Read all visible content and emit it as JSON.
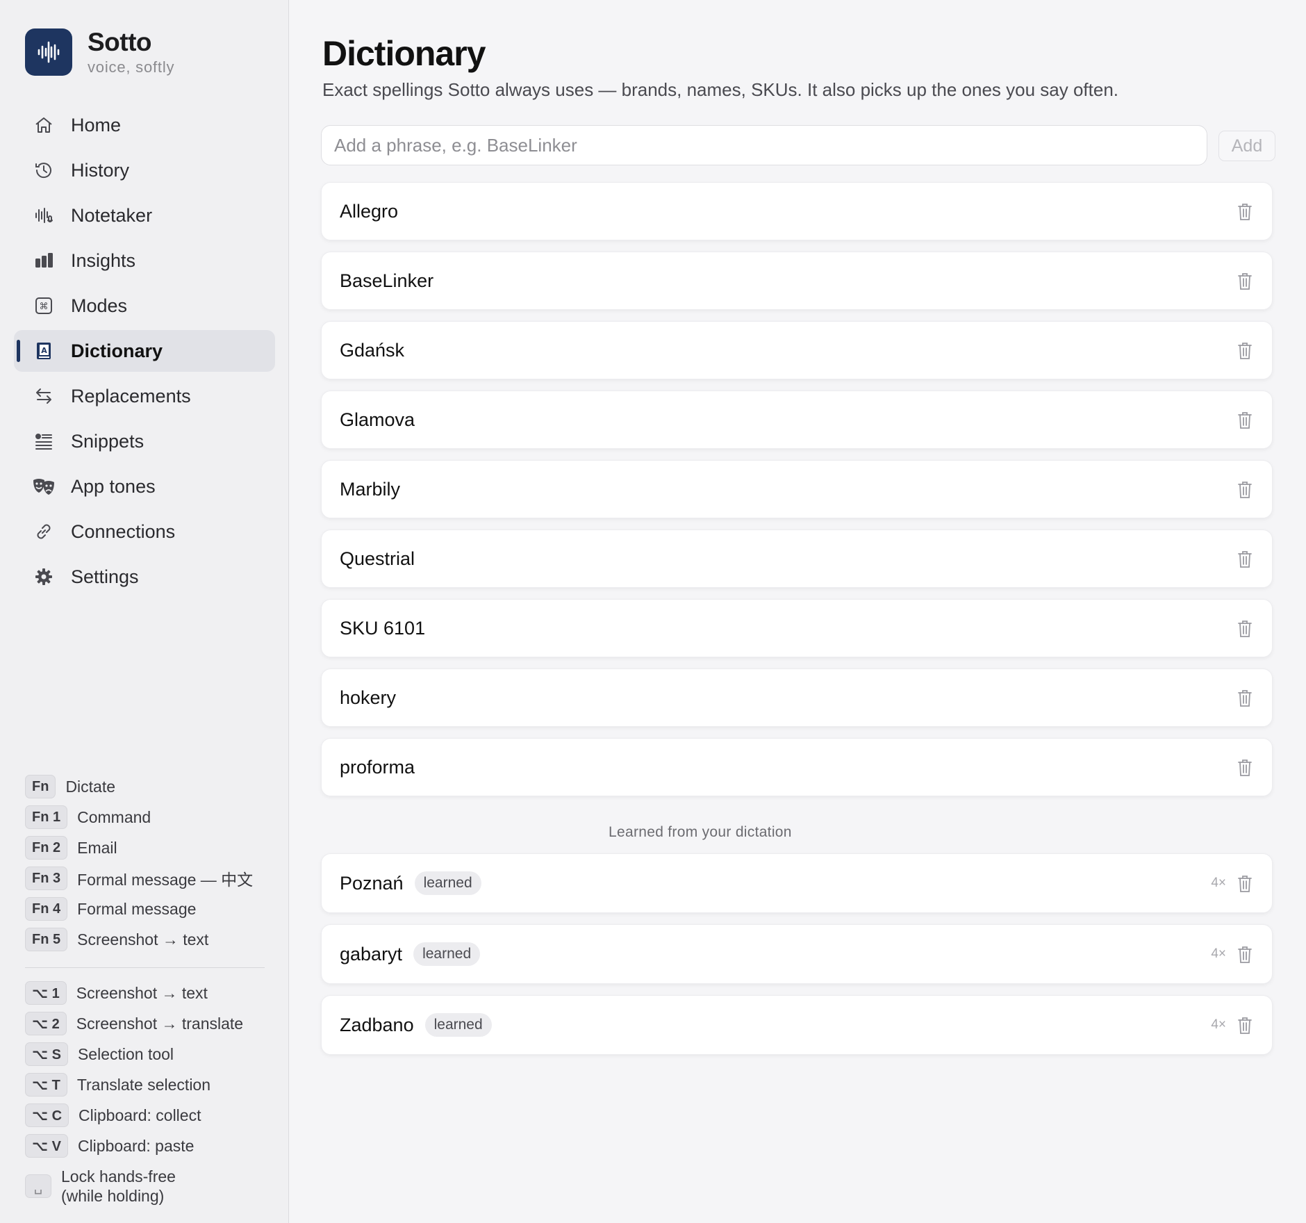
{
  "brand": {
    "name": "Sotto",
    "tagline": "voice, softly"
  },
  "nav": [
    {
      "label": "Home",
      "icon": "home-icon"
    },
    {
      "label": "History",
      "icon": "history-icon"
    },
    {
      "label": "Notetaker",
      "icon": "waveform-mic-icon"
    },
    {
      "label": "Insights",
      "icon": "bar-chart-icon"
    },
    {
      "label": "Modes",
      "icon": "command-key-icon"
    },
    {
      "label": "Dictionary",
      "icon": "dictionary-book-icon",
      "active": true
    },
    {
      "label": "Replacements",
      "icon": "swap-arrows-icon"
    },
    {
      "label": "Snippets",
      "icon": "snippet-list-icon"
    },
    {
      "label": "App tones",
      "icon": "theater-masks-icon"
    },
    {
      "label": "Connections",
      "icon": "link-icon"
    },
    {
      "label": "Settings",
      "icon": "gear-icon"
    }
  ],
  "shortcuts_fn": [
    {
      "key": "Fn",
      "label": "Dictate"
    },
    {
      "key": "Fn 1",
      "label": "Command"
    },
    {
      "key": "Fn 2",
      "label": "Email"
    },
    {
      "key": "Fn 3",
      "label": "Formal message — 中文"
    },
    {
      "key": "Fn 4",
      "label": "Formal message"
    },
    {
      "key": "Fn 5",
      "label": "Screenshot → text"
    }
  ],
  "shortcuts_opt": [
    {
      "key": "⌥ 1",
      "label": "Screenshot → text"
    },
    {
      "key": "⌥ 2",
      "label": "Screenshot → translate"
    },
    {
      "key": "⌥ S",
      "label": "Selection tool"
    },
    {
      "key": "⌥ T",
      "label": "Translate selection"
    },
    {
      "key": "⌥ C",
      "label": "Clipboard: collect"
    },
    {
      "key": "⌥ V",
      "label": "Clipboard: paste"
    }
  ],
  "shortcut_hold": {
    "key": "␣",
    "label": "Lock hands-free (while holding)"
  },
  "page": {
    "title": "Dictionary",
    "subtitle": "Exact spellings Sotto always uses — brands, names, SKUs. It also picks up the ones you say often.",
    "add_placeholder": "Add a phrase, e.g. BaseLinker",
    "add_value": "",
    "add_button": "Add"
  },
  "entries": [
    "Allegro",
    "BaseLinker",
    "Gdańsk",
    "Glamova",
    "Marbily",
    "Questrial",
    "SKU 6101",
    "hokery",
    "proforma"
  ],
  "learned_section_label": "Learned from your dictation",
  "learned": [
    {
      "term": "Poznań",
      "badge": "learned",
      "count": "4×"
    },
    {
      "term": "gabaryt",
      "badge": "learned",
      "count": "4×"
    },
    {
      "term": "Zadbano",
      "badge": "learned",
      "count": "4×"
    }
  ],
  "colors": {
    "accent": "#1e3560",
    "background": "#f5f5f7",
    "sidebar": "#f0f0f2"
  }
}
